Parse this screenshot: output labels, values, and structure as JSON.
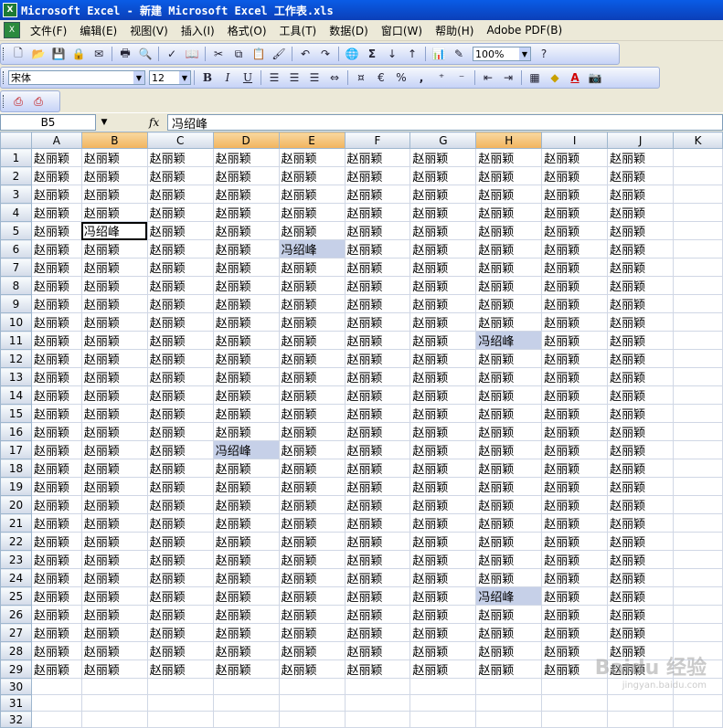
{
  "window": {
    "title": "Microsoft Excel - 新建 Microsoft Excel 工作表.xls"
  },
  "menu": [
    "文件(F)",
    "编辑(E)",
    "视图(V)",
    "插入(I)",
    "格式(O)",
    "工具(T)",
    "数据(D)",
    "窗口(W)",
    "帮助(H)",
    "Adobe PDF(B)"
  ],
  "toolbar": {
    "zoom": "100%",
    "sum_symbol": "Σ",
    "font_name": "宋体",
    "font_size": "12",
    "bold": "B",
    "italic": "I",
    "underline": "U",
    "percent": "%",
    "comma": ",",
    "font_color_letter": "A"
  },
  "formula_bar": {
    "name_box": "B5",
    "fx": "fx",
    "value": "冯绍峰"
  },
  "sheet": {
    "columns": [
      "A",
      "B",
      "C",
      "D",
      "E",
      "F",
      "G",
      "H",
      "I",
      "J",
      "K"
    ],
    "selected_columns": [
      "B",
      "D",
      "E",
      "H"
    ],
    "row_count": 32,
    "filled_rows": 29,
    "filled_columns": 10,
    "default_value": "赵丽颖",
    "active_cell": "B5",
    "special_cells": [
      {
        "ref": "B5",
        "value": "冯绍峰"
      },
      {
        "ref": "E6",
        "value": "冯绍峰"
      },
      {
        "ref": "H11",
        "value": "冯绍峰"
      },
      {
        "ref": "D17",
        "value": "冯绍峰"
      },
      {
        "ref": "H25",
        "value": "冯绍峰"
      }
    ]
  },
  "watermark": {
    "main": "Baidu 经验",
    "sub": "jingyan.baidu.com"
  }
}
